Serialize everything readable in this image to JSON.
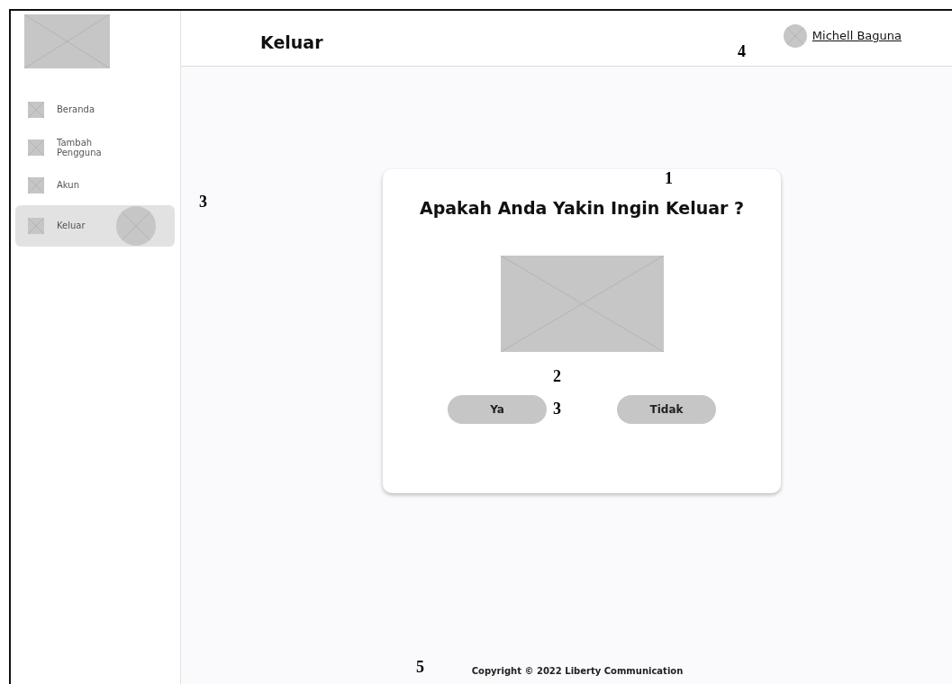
{
  "sidebar": {
    "items": [
      {
        "label": "Beranda",
        "selected": false
      },
      {
        "label": "Tambah Pengguna",
        "selected": false
      },
      {
        "label": "Akun",
        "selected": false
      },
      {
        "label": "Keluar",
        "selected": true
      }
    ]
  },
  "header": {
    "title": "Keluar",
    "user": "Michell Baguna"
  },
  "dialog": {
    "title": "Apakah Anda Yakin Ingin Keluar ?",
    "buttons": [
      "Ya",
      "Tidak"
    ]
  },
  "footer": {
    "copyright": "Copyright © 2022 Liberty Communication"
  },
  "annotations": [
    {
      "kind": "title",
      "label": "1"
    },
    {
      "kind": "image",
      "label": "2"
    },
    {
      "kind": "buttons",
      "label": "3"
    },
    {
      "kind": "sidebar",
      "label": "3"
    },
    {
      "kind": "user",
      "label": "4"
    },
    {
      "kind": "footer",
      "label": "5"
    }
  ]
}
